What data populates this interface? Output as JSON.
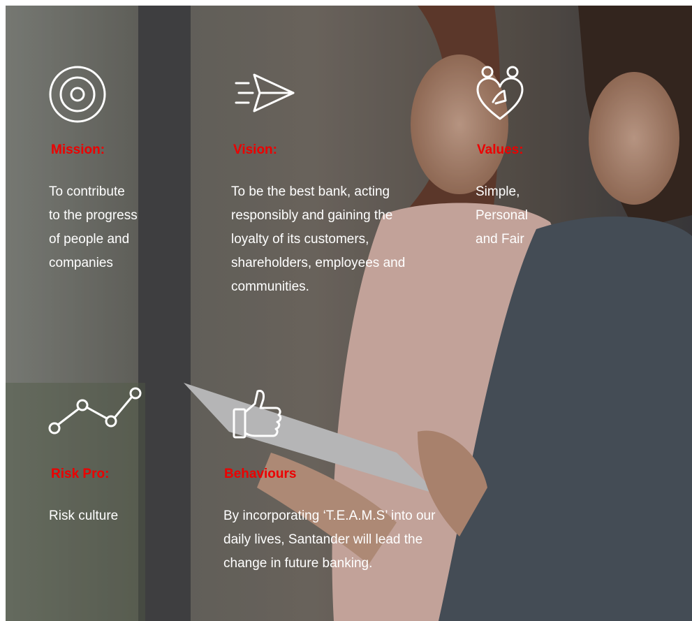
{
  "colors": {
    "accent": "#ec0000",
    "text": "#ffffff"
  },
  "image": {
    "description_icon": "photo-two-people-with-tablet"
  },
  "mission": {
    "icon": "target-icon",
    "heading": "Mission:",
    "lines": [
      "To contribute",
      "to the progress",
      "of people and",
      "companies"
    ]
  },
  "vision": {
    "icon": "paper-plane-icon",
    "heading": "Vision:",
    "lines": [
      "To be the best bank, acting",
      "responsibly and gaining the",
      "loyalty of its customers,",
      "shareholders, employees and",
      "communities."
    ]
  },
  "values": {
    "icon": "heart-people-icon",
    "heading": "Values:",
    "lines": [
      "Simple,",
      "Personal",
      "and Fair"
    ]
  },
  "risk": {
    "icon": "trend-line-icon",
    "heading": "Risk Pro:",
    "lines": [
      "Risk culture"
    ]
  },
  "behaviours": {
    "icon": "thumbs-up-icon",
    "heading": "Behaviours",
    "lines": [
      "By incorporating ‘T.E.A.M.S’ into our",
      "daily lives, Santander will lead the",
      "change in future banking."
    ]
  }
}
